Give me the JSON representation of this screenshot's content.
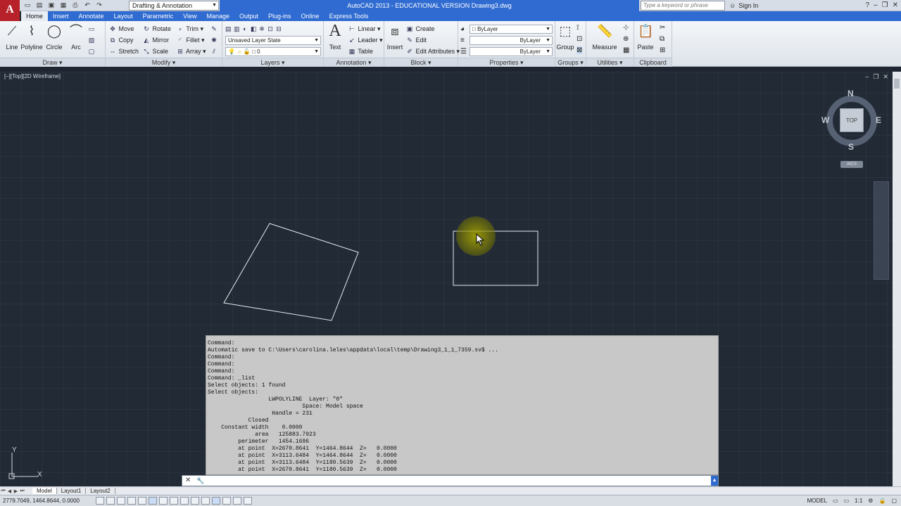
{
  "app": {
    "logo": "A",
    "title": "AutoCAD 2013 - EDUCATIONAL VERSION   Drawing3.dwg",
    "workspace": "Drafting & Annotation",
    "search_placeholder": "Type a keyword or phrase",
    "sign_in": "Sign In",
    "help": "?"
  },
  "ribbon_tabs": [
    "Home",
    "Insert",
    "Annotate",
    "Layout",
    "Parametric",
    "View",
    "Manage",
    "Output",
    "Plug-ins",
    "Online",
    "Express Tools"
  ],
  "panels": {
    "draw": {
      "title": "Draw",
      "buttons": [
        "Line",
        "Polyline",
        "Circle",
        "Arc"
      ]
    },
    "modify": {
      "title": "Modify",
      "items": [
        "Move",
        "Rotate",
        "Trim",
        "Copy",
        "Mirror",
        "Fillet",
        "Stretch",
        "Scale",
        "Array"
      ]
    },
    "layers": {
      "title": "Layers",
      "layer_state": "Unsaved Layer State",
      "current_layer": "0"
    },
    "annotation": {
      "title": "Annotation",
      "text": "Text",
      "linear": "Linear",
      "leader": "Leader",
      "table": "Table"
    },
    "block": {
      "title": "Block",
      "insert": "Insert",
      "create": "Create",
      "edit": "Edit",
      "edit_attributes": "Edit Attributes"
    },
    "properties": {
      "title": "Properties",
      "color": "ByLayer",
      "linetype": "ByLayer",
      "lineweight": "ByLayer"
    },
    "groups": {
      "title": "Groups",
      "group": "Group"
    },
    "utilities": {
      "title": "Utilities",
      "measure": "Measure"
    },
    "clipboard": {
      "title": "Clipboard",
      "paste": "Paste"
    }
  },
  "viewport": {
    "label": "[–][Top][2D Wireframe]",
    "viewcube": {
      "face": "TOP",
      "north": "N",
      "south": "S",
      "east": "E",
      "west": "W",
      "wcs": "WCS"
    },
    "ucs": {
      "x": "X",
      "y": "Y"
    }
  },
  "command": {
    "history": [
      "Command:",
      "Automatic save to C:\\Users\\carolina.leles\\appdata\\local\\temp\\Drawing3_1_1_7359.sv$ ...",
      "Command:",
      "Command:",
      "Command:",
      "Command: _list",
      "Select objects: 1 found",
      "Select objects:",
      "                  LWPOLYLINE  Layer: \"0\"",
      "                            Space: Model space",
      "                   Handle = 231",
      "            Closed",
      "    Constant width    0.0000",
      "              area   125883.7923",
      "         perimeter   1454.1696",
      "         at point  X=2670.8641  Y=1464.8644  Z=   0.0000",
      "         at point  X=3113.6484  Y=1464.8644  Z=   0.0000",
      "         at point  X=3113.6484  Y=1180.5639  Z=   0.0000",
      "         at point  X=2670.8641  Y=1180.5639  Z=   0.0000"
    ],
    "input_value": ""
  },
  "layout_tabs": [
    "Model",
    "Layout1",
    "Layout2"
  ],
  "status": {
    "coords": "2779.7049, 1464.8644, 0.0000",
    "model": "MODEL",
    "scale": "1:1"
  }
}
